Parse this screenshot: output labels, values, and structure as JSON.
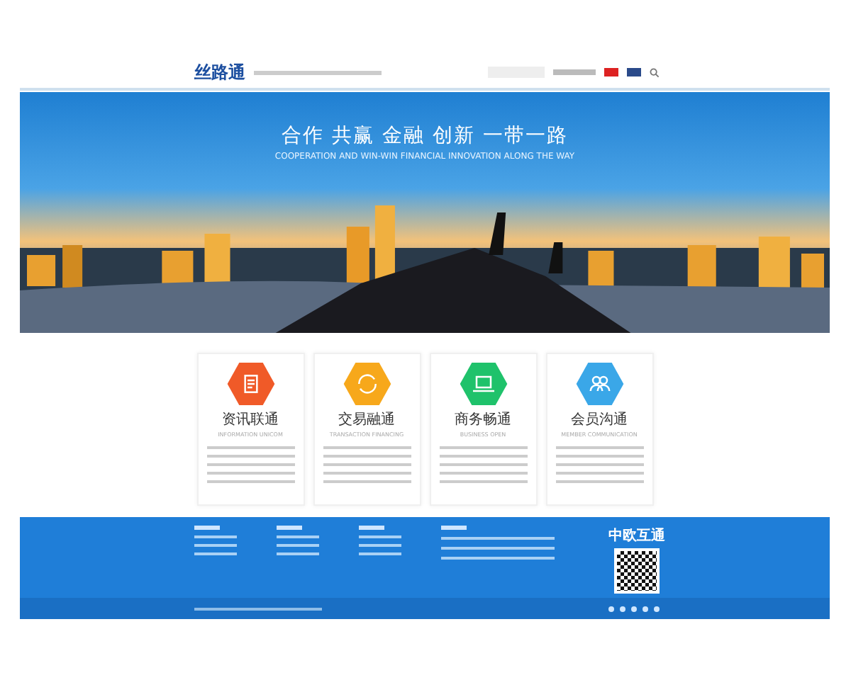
{
  "header": {
    "logo": "丝路通"
  },
  "banner": {
    "headline": "合作 共赢 金融 创新 一带一路",
    "subline": "COOPERATION AND WIN-WIN FINANCIAL INNOVATION ALONG THE WAY"
  },
  "cards": [
    {
      "title": "资讯联通",
      "subtitle": "INFORMATION UNICOM",
      "color": "#f05a28",
      "kind": "doc"
    },
    {
      "title": "交易融通",
      "subtitle": "TRANSACTION FINANCING",
      "color": "#f7a81b",
      "kind": "exchange"
    },
    {
      "title": "商务畅通",
      "subtitle": "BUSINESS OPEN",
      "color": "#1fc26b",
      "kind": "laptop"
    },
    {
      "title": "会员沟通",
      "subtitle": "MEMBER COMMUNICATION",
      "color": "#3aa7e8",
      "kind": "people"
    }
  ],
  "footer": {
    "logo": "中欧互通"
  }
}
